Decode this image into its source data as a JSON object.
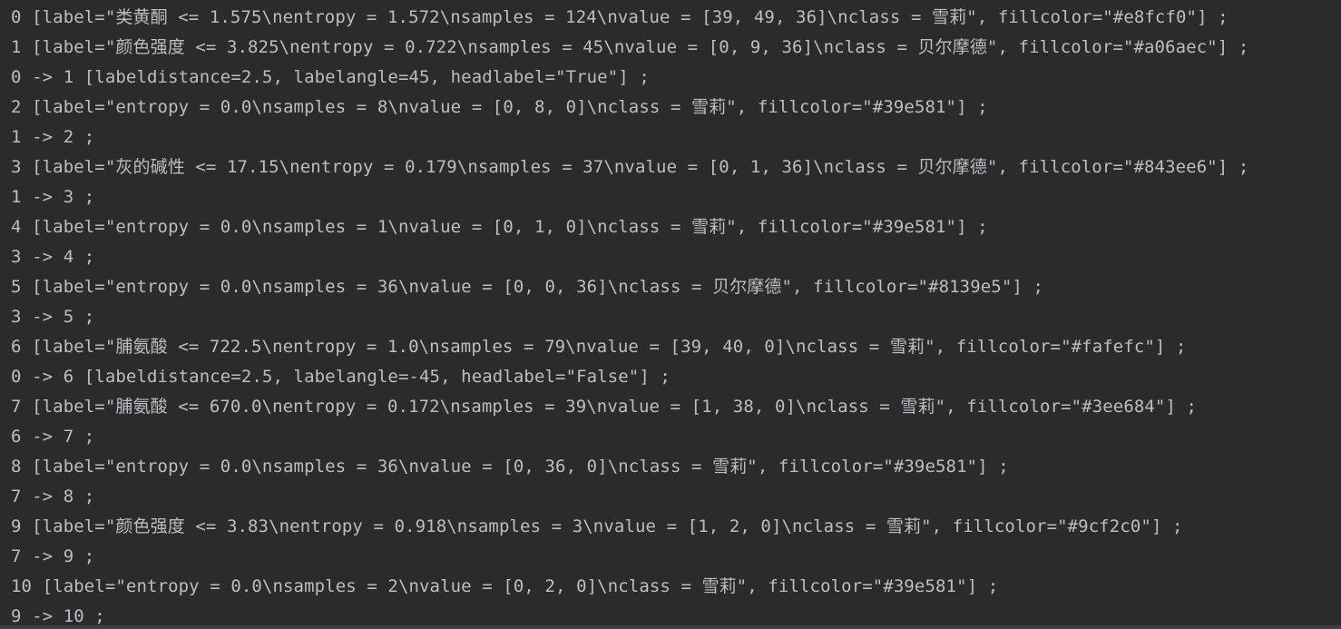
{
  "console": {
    "lines": [
      "0 [label=\"类黄酮 <= 1.575\\nentropy = 1.572\\nsamples = 124\\nvalue = [39, 49, 36]\\nclass = 雪莉\", fillcolor=\"#e8fcf0\"] ;",
      "1 [label=\"颜色强度 <= 3.825\\nentropy = 0.722\\nsamples = 45\\nvalue = [0, 9, 36]\\nclass = 贝尔摩德\", fillcolor=\"#a06aec\"] ;",
      "0 -> 1 [labeldistance=2.5, labelangle=45, headlabel=\"True\"] ;",
      "2 [label=\"entropy = 0.0\\nsamples = 8\\nvalue = [0, 8, 0]\\nclass = 雪莉\", fillcolor=\"#39e581\"] ;",
      "1 -> 2 ;",
      "3 [label=\"灰的碱性 <= 17.15\\nentropy = 0.179\\nsamples = 37\\nvalue = [0, 1, 36]\\nclass = 贝尔摩德\", fillcolor=\"#843ee6\"] ;",
      "1 -> 3 ;",
      "4 [label=\"entropy = 0.0\\nsamples = 1\\nvalue = [0, 1, 0]\\nclass = 雪莉\", fillcolor=\"#39e581\"] ;",
      "3 -> 4 ;",
      "5 [label=\"entropy = 0.0\\nsamples = 36\\nvalue = [0, 0, 36]\\nclass = 贝尔摩德\", fillcolor=\"#8139e5\"] ;",
      "3 -> 5 ;",
      "6 [label=\"脯氨酸 <= 722.5\\nentropy = 1.0\\nsamples = 79\\nvalue = [39, 40, 0]\\nclass = 雪莉\", fillcolor=\"#fafefc\"] ;",
      "0 -> 6 [labeldistance=2.5, labelangle=-45, headlabel=\"False\"] ;",
      "7 [label=\"脯氨酸 <= 670.0\\nentropy = 0.172\\nsamples = 39\\nvalue = [1, 38, 0]\\nclass = 雪莉\", fillcolor=\"#3ee684\"] ;",
      "6 -> 7 ;",
      "8 [label=\"entropy = 0.0\\nsamples = 36\\nvalue = [0, 36, 0]\\nclass = 雪莉\", fillcolor=\"#39e581\"] ;",
      "7 -> 8 ;",
      "9 [label=\"颜色强度 <= 3.83\\nentropy = 0.918\\nsamples = 3\\nvalue = [1, 2, 0]\\nclass = 雪莉\", fillcolor=\"#9cf2c0\"] ;",
      "7 -> 9 ;",
      "10 [label=\"entropy = 0.0\\nsamples = 2\\nvalue = [0, 2, 0]\\nclass = 雪莉\", fillcolor=\"#39e581\"] ;",
      "9 -> 10 ;"
    ]
  }
}
